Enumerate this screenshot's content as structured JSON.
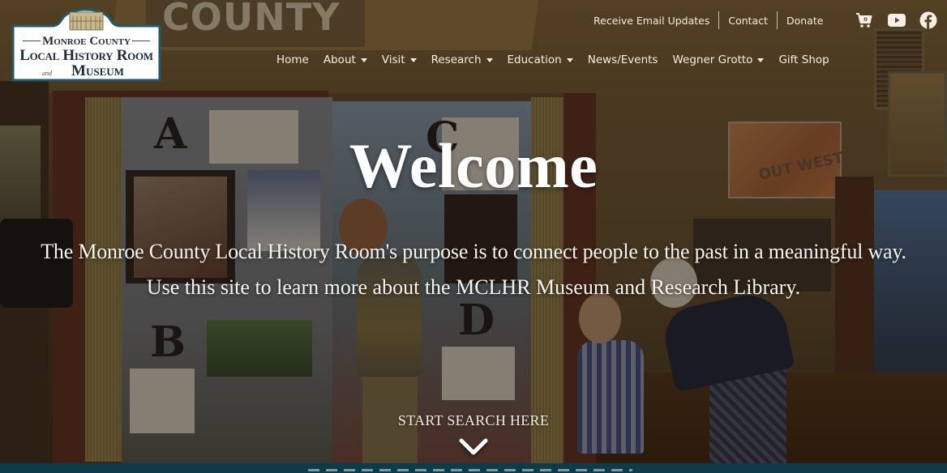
{
  "site": {
    "logo": {
      "line1": "Monroe County",
      "line2": "Local History Room",
      "line3_prefix": "and",
      "line3": "Museum"
    }
  },
  "utility_nav": {
    "items": [
      {
        "label": "Receive Email Updates"
      },
      {
        "label": "Contact"
      },
      {
        "label": "Donate"
      }
    ],
    "icons": [
      {
        "name": "cart-icon",
        "badge": "0"
      },
      {
        "name": "youtube-icon"
      },
      {
        "name": "facebook-icon"
      }
    ]
  },
  "main_nav": {
    "items": [
      {
        "label": "Home",
        "dropdown": false
      },
      {
        "label": "About",
        "dropdown": true
      },
      {
        "label": "Visit",
        "dropdown": true
      },
      {
        "label": "Research",
        "dropdown": true
      },
      {
        "label": "Education",
        "dropdown": true
      },
      {
        "label": "News/Events",
        "dropdown": false
      },
      {
        "label": "Wegner Grotto",
        "dropdown": true
      },
      {
        "label": "Gift Shop",
        "dropdown": false
      }
    ]
  },
  "hero": {
    "title": "Welcome",
    "tagline1": "The Monroe County Local History Room's purpose is to connect people to the past in a meaningful way.",
    "tagline2": "Use this site to learn more about the MCLHR Museum and Research Library.",
    "cta_label": "START SEARCH HERE",
    "background_words": {
      "sign": "COUNTY",
      "poster": "OUT WEST"
    }
  },
  "colors": {
    "bottom_bar": "#0e3b4a",
    "logo_border": "#1f5a68",
    "logo_text": "#1e2a3a",
    "text": "#ffffff"
  }
}
